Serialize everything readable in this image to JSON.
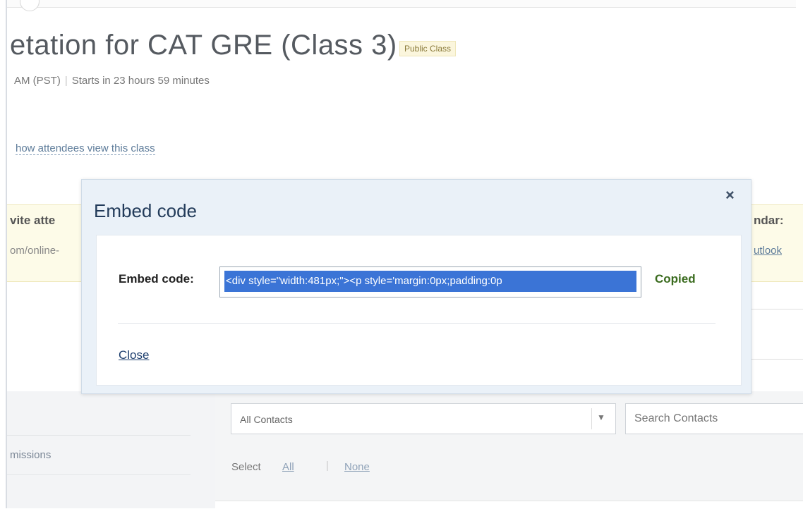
{
  "page": {
    "class_title": "etation for CAT GRE (Class 3)",
    "badge": "Public Class",
    "time_text": "AM (PST)",
    "starts_in": "Starts in 23 hours 59 minutes",
    "view_link": "how attendees view this class"
  },
  "invite": {
    "label": "vite atte",
    "url": "om/online-",
    "calendar_label": "ndar:",
    "outlook_link": "utlook"
  },
  "sidebar": {
    "permissions_label": "missions"
  },
  "contacts": {
    "filter_value": "All Contacts",
    "search_placeholder": "Search Contacts",
    "select_label": "Select",
    "select_all": "All",
    "select_separator": "|",
    "select_none": "None"
  },
  "modal": {
    "title": "Embed code",
    "close_icon": "×",
    "embed_label": "Embed code:",
    "embed_value": "<div style=\"width:481px;\"><p style='margin:0px;padding:0p",
    "status": "Copied",
    "close_link": "Close"
  },
  "colors": {
    "selection": "#3b74d6",
    "copied": "#3a6b1e",
    "badge_bg": "#fbf6dd",
    "invite_bg": "#fdfbe8"
  }
}
